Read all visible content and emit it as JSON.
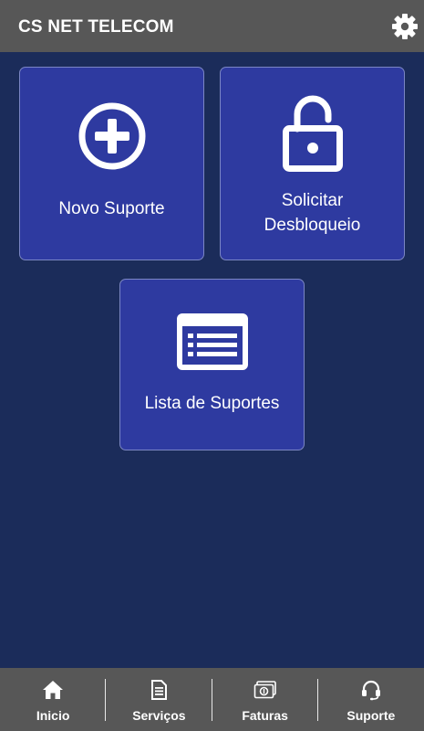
{
  "header": {
    "title": "CS NET TELECOM",
    "settings_icon": "gear-icon"
  },
  "cards": {
    "novo_suporte": {
      "label": "Novo Suporte",
      "icon": "plus-circle-icon"
    },
    "solicitar_desbloqueio": {
      "label_line1": "Solicitar",
      "label_line2": "Desbloqueio",
      "icon": "unlock-icon"
    },
    "lista_suportes": {
      "label": "Lista de Suportes",
      "icon": "list-icon"
    }
  },
  "bottom_nav": {
    "items": [
      {
        "label": "Inicio",
        "icon": "home-icon"
      },
      {
        "label": "Serviços",
        "icon": "document-icon"
      },
      {
        "label": "Faturas",
        "icon": "money-icon"
      },
      {
        "label": "Suporte",
        "icon": "headset-icon"
      }
    ]
  },
  "colors": {
    "header_bg": "#575757",
    "page_bg": "#1b2c5a",
    "card_bg": "#2e3aa0",
    "card_border": "#7b86c4",
    "text": "#ffffff"
  }
}
